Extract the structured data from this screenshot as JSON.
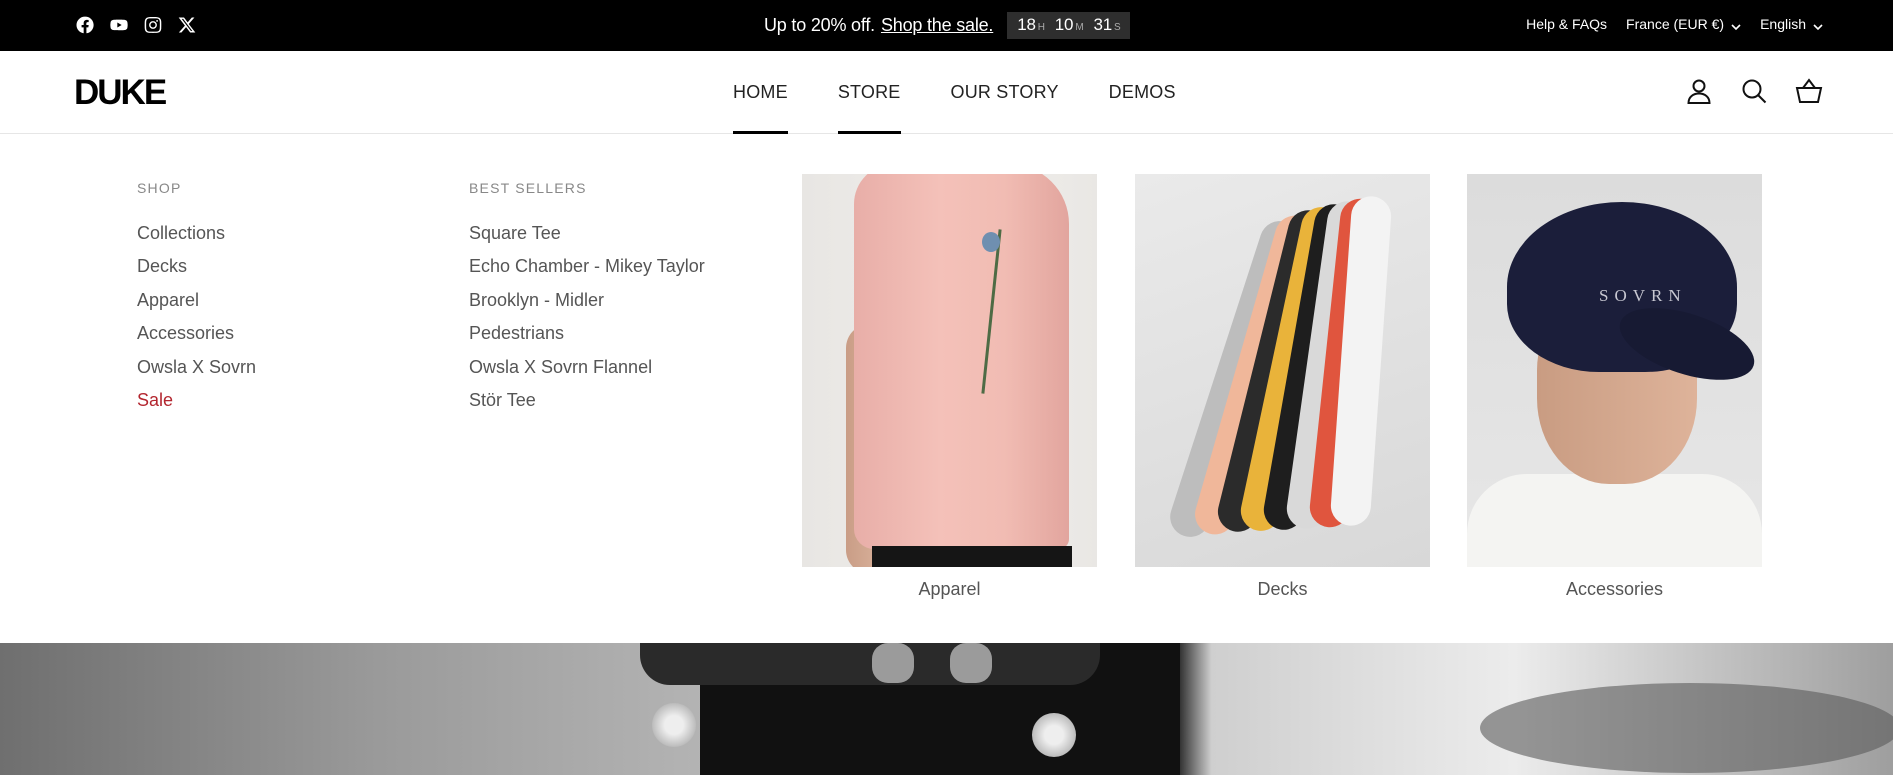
{
  "announcement": {
    "text": "Up to 20% off.",
    "link": "Shop the sale.",
    "countdown": [
      {
        "value": "18",
        "label": "H"
      },
      {
        "value": "10",
        "label": "M"
      },
      {
        "value": "31",
        "label": "S"
      }
    ]
  },
  "social": [
    "facebook-icon",
    "youtube-icon",
    "instagram-icon",
    "x-icon"
  ],
  "toplinks": {
    "help": "Help & FAQs",
    "currency": "France (EUR €)",
    "language": "English"
  },
  "header": {
    "logo": "DUKE",
    "nav": [
      "HOME",
      "STORE",
      "OUR STORY",
      "DEMOS"
    ]
  },
  "mega": {
    "shop": {
      "heading": "SHOP",
      "links": [
        "Collections",
        "Decks",
        "Apparel",
        "Accessories",
        "Owsla X Sovrn",
        "Sale"
      ]
    },
    "best_sellers": {
      "heading": "BEST SELLERS",
      "links": [
        "Square Tee",
        "Echo Chamber - Mikey Taylor",
        "Brooklyn - Midler",
        "Pedestrians",
        "Owsla X Sovrn Flannel",
        "Stör Tee"
      ]
    },
    "cards": [
      "Apparel",
      "Decks",
      "Accessories"
    ],
    "cap_text": "SOVRN"
  },
  "colors": {
    "topbar": "#000000",
    "sale": "#b3262f",
    "muted": "#555555"
  }
}
